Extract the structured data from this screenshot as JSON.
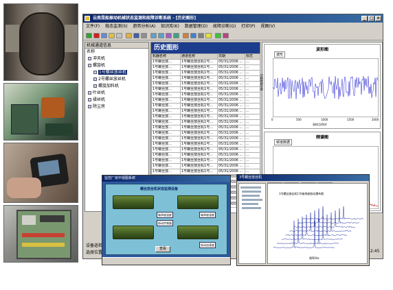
{
  "window": {
    "title": "云南昆船振动机械状态监测和故障诊断系统 - [历史图形]",
    "menu": [
      "文件(F)",
      "稳态监测(S)",
      "趋势分析(A)",
      "知识库(K)",
      "数据管理(D)",
      "故障诊断(G)",
      "打印(P)",
      "视图(V)"
    ]
  },
  "tree": {
    "header": "机械通道信息",
    "column": "名称",
    "items": [
      {
        "label": "冲天机",
        "level": 1
      },
      {
        "label": "螺旋机",
        "level": 1
      },
      {
        "label": "1号螺丝放丝机",
        "level": 2,
        "selected": true
      },
      {
        "label": "2号螺丝放丝机",
        "level": 2
      },
      {
        "label": "螺旋加料机",
        "level": 2
      },
      {
        "label": "叶丝机",
        "level": 1
      },
      {
        "label": "揉丝机",
        "level": 1
      },
      {
        "label": "除尘房",
        "level": 1
      }
    ]
  },
  "history": {
    "heading": "历史图形",
    "columns": [
      "机器名称",
      "通道名称",
      "日期",
      "标志"
    ],
    "rows": [
      [
        "1号螺丝放...",
        "1号螺丝放丝机1号...",
        "05/31/2006 ...",
        "..."
      ],
      [
        "1号螺丝放...",
        "1号螺丝放丝机1号...",
        "05/31/2006 ...",
        "..."
      ],
      [
        "1号螺丝放...",
        "1号螺丝放丝机1号...",
        "05/31/2006 ...",
        "..."
      ],
      [
        "1号螺丝放...",
        "1号螺丝放丝机1号...",
        "05/31/2006 ...",
        "..."
      ],
      [
        "1号螺丝放...",
        "1号螺丝放丝机1号...",
        "05/31/2006 ...",
        "..."
      ],
      [
        "1号螺丝放...",
        "1号螺丝放丝机1号...",
        "05/31/2006 ...",
        "..."
      ],
      [
        "1号螺丝放...",
        "1号螺丝放丝机1号...",
        "05/31/2006 ...",
        "..."
      ],
      [
        "1号螺丝放...",
        "1号螺丝放丝机1号...",
        "05/31/2006 ...",
        "..."
      ],
      [
        "1号螺丝放...",
        "1号螺丝放丝机1号...",
        "05/31/2006 ...",
        "..."
      ],
      [
        "1号螺丝放...",
        "1号螺丝放丝机1号...",
        "05/31/2006 ...",
        "..."
      ],
      [
        "1号螺丝放...",
        "1号螺丝放丝机1号...",
        "05/31/2006 ...",
        "..."
      ],
      [
        "1号螺丝放...",
        "1号螺丝放丝机1号...",
        "05/31/2006 ...",
        "..."
      ],
      [
        "1号螺丝放...",
        "1号螺丝放丝机1号...",
        "05/31/2006 ...",
        "..."
      ],
      [
        "1号螺丝放...",
        "1号螺丝放丝机1号...",
        "05/31/2006 ...",
        "..."
      ],
      [
        "1号螺丝放...",
        "1号螺丝放丝机1号...",
        "05/31/2006 ...",
        "..."
      ],
      [
        "1号螺丝放...",
        "1号螺丝放丝机1号...",
        "05/31/2006 ...",
        "..."
      ],
      [
        "1号螺丝放...",
        "1号螺丝放丝机1号...",
        "05/31/2006 ...",
        "..."
      ],
      [
        "1号螺丝放...",
        "1号螺丝放丝机1号...",
        "05/31/2006 ...",
        "..."
      ],
      [
        "1号螺丝放...",
        "1号螺丝放丝机1号...",
        "05/31/2006 ...",
        "..."
      ],
      [
        "1号螺丝放...",
        "1号螺丝放丝机1号...",
        "05/31/2006 ...",
        "..."
      ],
      [
        "1号螺丝放...",
        "1号螺丝放丝机1号...",
        "05/31/2006 ...",
        "..."
      ],
      [
        "1号螺丝放...",
        "1号螺丝放丝机1号...",
        "05/31/2006 ...",
        "..."
      ],
      [
        "1号螺丝放...",
        "1号螺丝放丝机1号...",
        "05/31/2006 ...",
        "..."
      ],
      [
        "1号螺丝放...",
        "1号螺丝放丝机1号...",
        "05/31/2006 ...",
        "..."
      ],
      [
        "1号螺丝放...",
        "1号螺丝放丝机1号...",
        "05/31/2006 ...",
        "..."
      ],
      [
        "1号螺丝放...",
        "1号螺丝放丝机1号...",
        "05/31/2006 ...",
        "..."
      ],
      [
        "1号螺丝放...",
        "1号螺丝放丝机1号...",
        "05/31/2006 ...",
        "..."
      ]
    ]
  },
  "charts": {
    "waveform": {
      "title": "波形图",
      "legend": "波形",
      "xlabel": "采样点/Dot",
      "ylabel": "振动加速度/g",
      "ticks": [
        "0",
        "500",
        "1000",
        "1500",
        "2000"
      ]
    },
    "spectrum": {
      "title": "频谱图",
      "legend": "频谱数据"
    }
  },
  "status": {
    "labels": [
      "设备巡检单",
      "选择位置:"
    ],
    "clock": "42:45"
  },
  "overlay1": {
    "title": "监控厂房中视图系统",
    "heading": "螺丝放丝机状态监测设备",
    "callouts": [
      "轴承座温度",
      "振动传感器",
      "轴承座温度",
      "振动加速度"
    ],
    "button": "查看"
  },
  "overlay2": {
    "title": "3号螺丝放丝机",
    "tabs": [
      "历史数据",
      "趋势分析",
      "频谱图表",
      "瀑布图表"
    ],
    "plot_title": "1号螺丝放丝机1号轴承座振动瀑布图",
    "xlabel": "频率/Hz"
  },
  "colors": {
    "title_blue": "#0a246a",
    "heading_blue": "#1c3c8c",
    "signal_blue": "#1a1ad0",
    "panel_gray": "#d4d0c8"
  }
}
